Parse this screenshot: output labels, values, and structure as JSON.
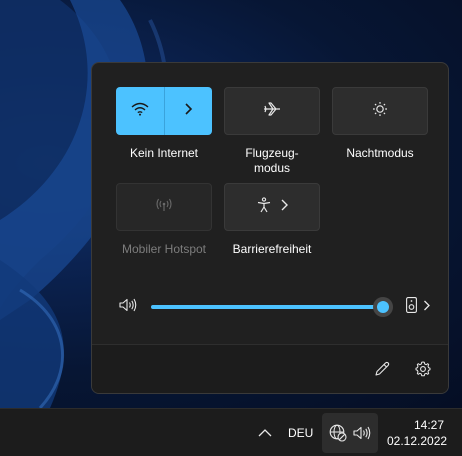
{
  "quick_settings": {
    "tiles": [
      {
        "id": "wifi",
        "label": "Kein Internet",
        "icon": "wifi-icon",
        "state": "active",
        "expand_icon": "chevron-right-icon"
      },
      {
        "id": "airplane",
        "label_line1": "Flugzeug-",
        "label_line2": "modus",
        "icon": "airplane-icon",
        "state": "off"
      },
      {
        "id": "night",
        "label": "Nachtmodus",
        "icon": "brightness-icon",
        "state": "off"
      },
      {
        "id": "hotspot",
        "label": "Mobiler Hotspot",
        "icon": "hotspot-icon",
        "state": "disabled"
      },
      {
        "id": "accessibility",
        "label": "Barrierefreiheit",
        "icon": "accessibility-icon",
        "expand_icon": "chevron-right-icon",
        "state": "off"
      }
    ],
    "volume": {
      "level": 1.0,
      "speaker_icon": "speaker-icon",
      "output_icon": "speaker-device-icon",
      "more_icon": "chevron-right-icon"
    },
    "footer": {
      "edit_icon": "pencil-icon",
      "settings_icon": "gear-icon"
    }
  },
  "taskbar": {
    "overflow_icon": "chevron-up-icon",
    "language": "DEU",
    "network_icon": "globe-no-internet-icon",
    "volume_icon": "speaker-icon",
    "time": "14:27",
    "date": "02.12.2022"
  },
  "colors": {
    "accent": "#4cc2ff",
    "panel": "#202020",
    "tile": "#2d2d2d"
  }
}
